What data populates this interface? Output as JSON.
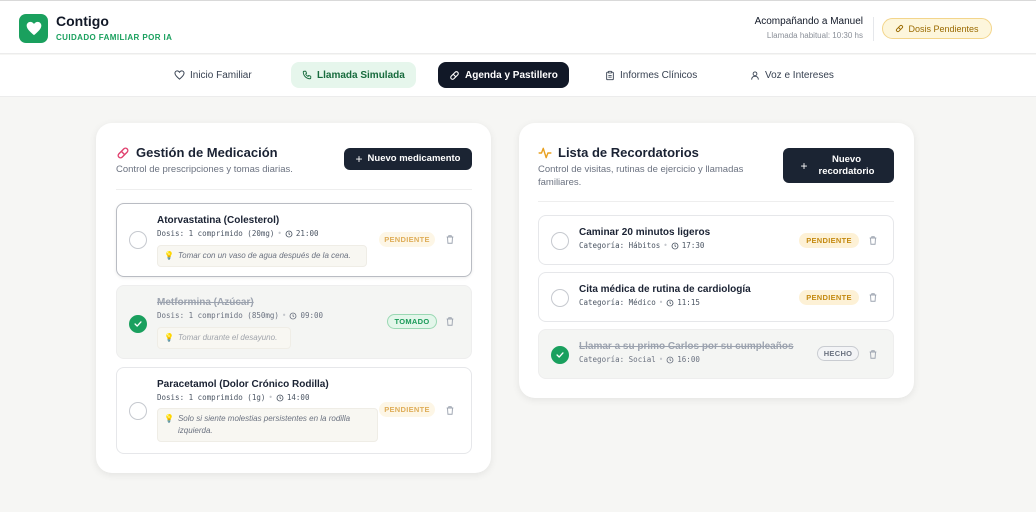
{
  "app": {
    "name": "Contigo",
    "tagline": "CUIDADO FAMILIAR POR IA"
  },
  "header": {
    "companion": "Acompañando a Manuel",
    "habit_time": "Llamada habitual: 10:30 hs",
    "pending_button": "Dosis Pendientes"
  },
  "nav": [
    {
      "label": "Inicio Familiar",
      "icon": "heart-icon"
    },
    {
      "label": "Llamada Simulada",
      "icon": "phone-icon"
    },
    {
      "label": "Agenda y Pastillero",
      "icon": "pill-icon"
    },
    {
      "label": "Informes Clínicos",
      "icon": "clipboard-icon"
    },
    {
      "label": "Voz e Intereses",
      "icon": "user-icon"
    }
  ],
  "medication": {
    "title": "Gestión de Medicación",
    "subtitle": "Control de prescripciones y tomas diarias.",
    "new_button": "Nuevo medicamento",
    "items": [
      {
        "name": "Atorvastatina (Colesterol)",
        "dose": "Dosis: 1 comprimido (20mg)",
        "time": "21:00",
        "note": "Tomar con un vaso de agua después de la cena.",
        "status": "PENDIENTE"
      },
      {
        "name": "Metformina (Azúcar)",
        "dose": "Dosis: 1 comprimido (850mg)",
        "time": "09:00",
        "note": "Tomar durante el desayuno.",
        "status": "TOMADO"
      },
      {
        "name": "Paracetamol (Dolor Crónico Rodilla)",
        "dose": "Dosis: 1 comprimido (1g)",
        "time": "14:00",
        "note": "Solo si siente molestias persistentes en la rodilla izquierda.",
        "status": "PENDIENTE"
      }
    ]
  },
  "reminders": {
    "title": "Lista de Recordatorios",
    "subtitle": "Control de visitas, rutinas de ejercicio y llamadas familiares.",
    "new_button": "Nuevo recordatorio",
    "items": [
      {
        "name": "Caminar 20 minutos ligeros",
        "category": "Categoría: Hábitos",
        "time": "17:30",
        "status": "PENDIENTE"
      },
      {
        "name": "Cita médica de rutina de cardiología",
        "category": "Categoría: Médico",
        "time": "11:15",
        "status": "PENDIENTE"
      },
      {
        "name": "Llamar a su primo Carlos por su cumpleaños",
        "category": "Categoría: Social",
        "time": "16:00",
        "status": "HECHO"
      }
    ]
  },
  "colors": {
    "brand_green": "#1aa05e",
    "dark": "#1b2433",
    "pending": "#c48a12",
    "accent_pink": "#e0406e",
    "accent_orange": "#e8a020"
  }
}
